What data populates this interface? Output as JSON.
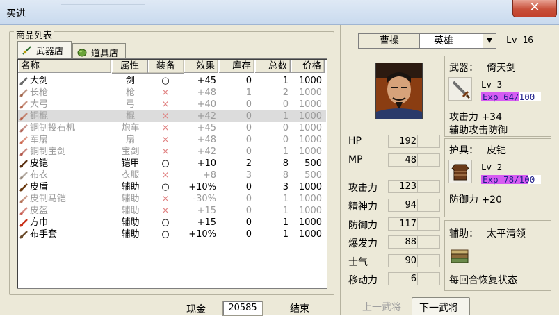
{
  "window": {
    "title": "买进"
  },
  "group": {
    "label": "商品列表"
  },
  "tabs": [
    {
      "label": "武器店"
    },
    {
      "label": "道具店"
    }
  ],
  "table": {
    "headers": [
      "名称",
      "属性",
      "装备",
      "效果",
      "库存",
      "总数",
      "价格"
    ],
    "rows": [
      {
        "icon": "sword-icon",
        "name": "大剑",
        "type": "剑",
        "equip": "○",
        "effect": "+45",
        "stock": "0",
        "total": "1",
        "price": "1000",
        "dim": false
      },
      {
        "icon": "spear-icon",
        "name": "长枪",
        "type": "枪",
        "equip": "×",
        "effect": "+48",
        "stock": "1",
        "total": "2",
        "price": "1000",
        "dim": true
      },
      {
        "icon": "bow-icon",
        "name": "大弓",
        "type": "弓",
        "equip": "×",
        "effect": "+40",
        "stock": "0",
        "total": "0",
        "price": "1000",
        "dim": true
      },
      {
        "icon": "staff-icon",
        "name": "铜棍",
        "type": "棍",
        "equip": "×",
        "effect": "+42",
        "stock": "0",
        "total": "1",
        "price": "1000",
        "dim": true
      },
      {
        "icon": "catapult-icon",
        "name": "铜制投石机",
        "type": "炮车",
        "equip": "×",
        "effect": "+45",
        "stock": "0",
        "total": "0",
        "price": "1000",
        "dim": true
      },
      {
        "icon": "fan-icon",
        "name": "军扇",
        "type": "扇",
        "equip": "×",
        "effect": "+48",
        "stock": "0",
        "total": "0",
        "price": "1000",
        "dim": true
      },
      {
        "icon": "precious-sword-icon",
        "name": "铜制宝剑",
        "type": "宝剑",
        "equip": "×",
        "effect": "+42",
        "stock": "0",
        "total": "1",
        "price": "1000",
        "dim": true
      },
      {
        "icon": "leather-armor-icon",
        "name": "皮铠",
        "type": "铠甲",
        "equip": "○",
        "effect": "+10",
        "stock": "2",
        "total": "8",
        "price": "500",
        "dim": false
      },
      {
        "icon": "cloth-robe-icon",
        "name": "布衣",
        "type": "衣服",
        "equip": "×",
        "effect": "+8",
        "stock": "3",
        "total": "8",
        "price": "500",
        "dim": true
      },
      {
        "icon": "leather-shield-icon",
        "name": "皮盾",
        "type": "辅助",
        "equip": "○",
        "effect": "+10%",
        "stock": "0",
        "total": "3",
        "price": "1000",
        "dim": false
      },
      {
        "icon": "horse-armor-icon",
        "name": "皮制马铠",
        "type": "辅助",
        "equip": "×",
        "effect": "-30%",
        "stock": "0",
        "total": "1",
        "price": "1000",
        "dim": true
      },
      {
        "icon": "leather-helmet-icon",
        "name": "皮盔",
        "type": "辅助",
        "equip": "×",
        "effect": "+15",
        "stock": "0",
        "total": "1",
        "price": "1000",
        "dim": true
      },
      {
        "icon": "headscarf-icon",
        "name": "方巾",
        "type": "辅助",
        "equip": "○",
        "effect": "+15",
        "stock": "0",
        "total": "1",
        "price": "1000",
        "dim": false
      },
      {
        "icon": "cloth-gloves-icon",
        "name": "布手套",
        "type": "辅助",
        "equip": "○",
        "effect": "+10%",
        "stock": "0",
        "total": "1",
        "price": "1000",
        "dim": false
      }
    ]
  },
  "money": {
    "label": "现金",
    "value": "20585"
  },
  "buttons": {
    "end": "结束",
    "prev_general": "上一武将",
    "next_general": "下一武将"
  },
  "general": {
    "name": "曹操",
    "class": "英雄",
    "level": "Lv 16"
  },
  "stats": [
    {
      "label": "HP",
      "value": "192"
    },
    {
      "label": "MP",
      "value": "48"
    },
    {
      "label": "攻击力",
      "value": "123"
    },
    {
      "label": "精神力",
      "value": "94"
    },
    {
      "label": "防御力",
      "value": "117"
    },
    {
      "label": "爆发力",
      "value": "88"
    },
    {
      "label": "士气",
      "value": "90"
    },
    {
      "label": "移动力",
      "value": "6"
    }
  ],
  "weapon": {
    "title": "武器：",
    "name": "倚天剑",
    "lv": "Lv  3",
    "exp": "Exp 64/100",
    "exp_fraction": 0.64,
    "effect1": "攻击力 +34",
    "effect2": "辅助攻击防御"
  },
  "armor": {
    "title": "护具：",
    "name": "皮铠",
    "lv": "Lv  2",
    "exp": "Exp 78/100",
    "exp_fraction": 0.78,
    "effect1": "防御力 +20"
  },
  "accessory": {
    "title": "辅助：",
    "name": "太平清领",
    "effect1": "每回合恢复状态"
  },
  "colors": {
    "exp_bar": "#d65cf2",
    "x_mark": "#d03030",
    "close_button": "#c8503a"
  }
}
